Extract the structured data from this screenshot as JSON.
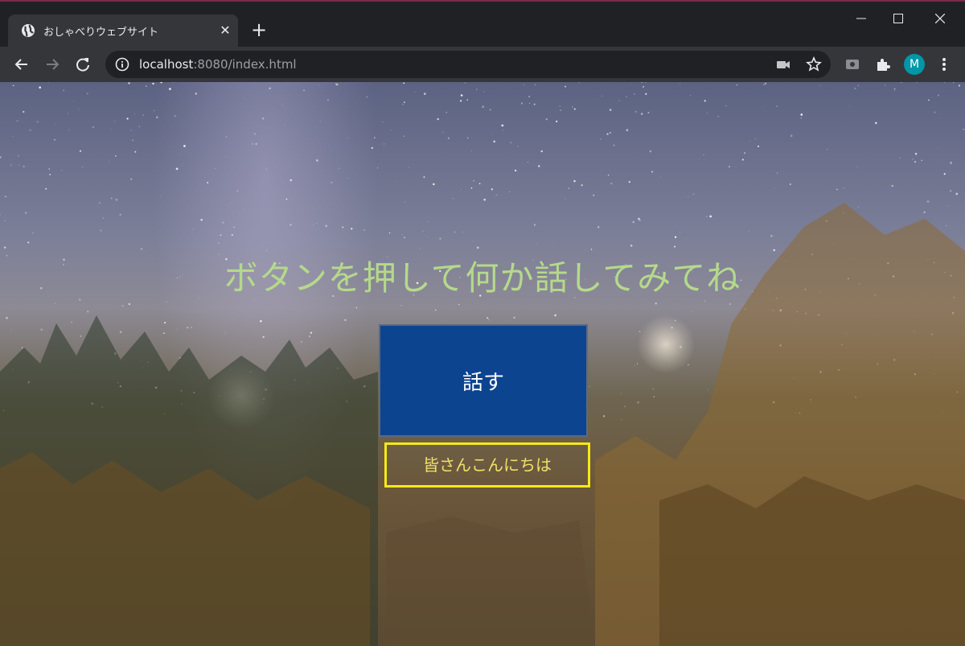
{
  "browser": {
    "tab_title": "おしゃべりウェブサイト",
    "tab_close_glyph": "✕",
    "new_tab_glyph": "+",
    "url_host": "localhost",
    "url_rest": ":8080/index.html",
    "profile_initial": "M",
    "icons": [
      "globe-icon",
      "close-icon",
      "plus-icon",
      "minimize-icon",
      "maximize-icon",
      "window-close-icon",
      "back-arrow-icon",
      "forward-arrow-icon",
      "reload-icon",
      "info-icon",
      "camera-icon",
      "star-icon",
      "screenshot-icon",
      "puzzle-icon",
      "menu-dots-icon"
    ]
  },
  "page": {
    "headline": "ボタンを押して何か話してみてね",
    "speak_button_label": "話す",
    "speech_text": "皆さんこんにちは"
  },
  "colors": {
    "headline": "#b5d98a",
    "button_bg": "#0d4490",
    "speech_border": "#f5ea14",
    "speech_text": "#f0e06a",
    "avatar_bg": "#0097a7",
    "chrome_dark": "#202124",
    "chrome_toolbar": "#35363a"
  }
}
